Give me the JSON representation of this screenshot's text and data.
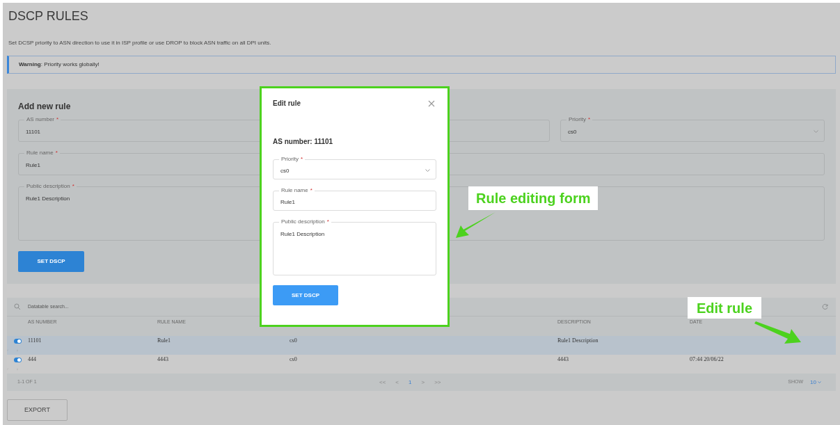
{
  "page": {
    "title": "DSCP RULES",
    "description": "Set DCSP priority to ASN direction to use it in ISP profile or use DROP to block ASN traffic on all DPI units.",
    "warning": "**Warning**: Priority works globally!"
  },
  "add_form": {
    "title": "Add new rule",
    "fields": [
      {
        "kind": "input",
        "label": "AS number",
        "required_mark": "*",
        "value": "11101"
      },
      {
        "kind": "select",
        "label": "Priority",
        "required_mark": "*",
        "value": "cs0"
      },
      {
        "kind": "input",
        "label": "Rule name",
        "required_mark": "*",
        "value": "Rule1"
      },
      {
        "kind": "textarea",
        "label": "Public description",
        "required_mark": "*",
        "value": "Rule1 Description"
      }
    ],
    "button": "SET DSCP"
  },
  "table": {
    "search_placeholder": "Datatable search...",
    "columns": [
      {
        "label": "AS NUMBER"
      },
      {
        "label": "RULE NAME"
      },
      {},
      {},
      {
        "label": "DESCRIPTION"
      },
      {
        "label": "DATE"
      }
    ],
    "rows": [
      {
        "selected": true,
        "enabled": true,
        "cells": [
          "11101",
          "Rule1",
          "cs0",
          "",
          "Rule1 Description",
          ""
        ]
      },
      {
        "selected": false,
        "enabled": true,
        "cells": [
          "444",
          "4443",
          "cs0",
          "",
          "4443",
          "07:44 20/06/22"
        ]
      }
    ],
    "footer": {
      "range": "1-1 OF 1",
      "pages": [
        {
          "label": "<<",
          "selected": false
        },
        {
          "label": "<",
          "selected": false
        },
        {
          "label": "1",
          "selected": true
        },
        {
          "label": ">",
          "selected": false
        },
        {
          "label": ">>",
          "selected": false
        }
      ],
      "show_label": "SHOW",
      "show_value": "10"
    }
  },
  "export_button": "EXPORT",
  "modal": {
    "title": "Edit rule",
    "subtitle": "AS number: 11101",
    "fields": [
      {
        "kind": "select",
        "label": "Priority",
        "required_mark": "*",
        "value": "cs0"
      },
      {
        "kind": "input",
        "label": "Rule name",
        "required_mark": "*",
        "value": "Rule1"
      },
      {
        "kind": "textarea",
        "label": "Public description",
        "required_mark": "*",
        "value": "Rule1 Description"
      }
    ],
    "button": "SET DSCP"
  },
  "callouts": [
    "Rule editing form",
    "Edit rule"
  ]
}
